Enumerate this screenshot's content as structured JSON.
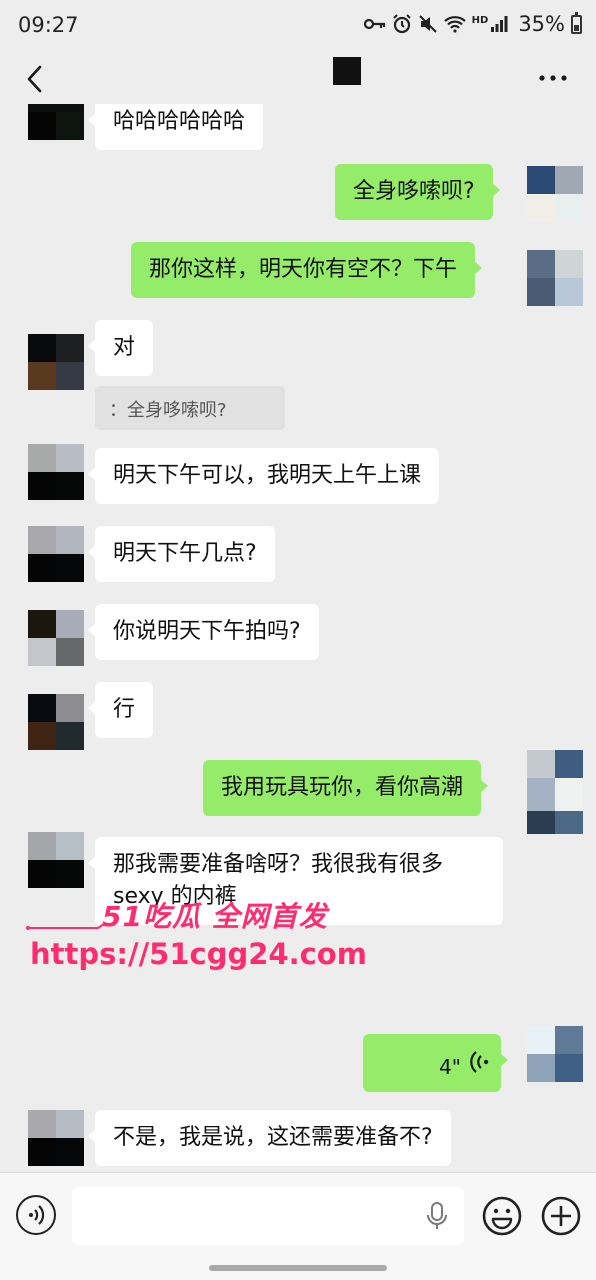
{
  "status_bar": {
    "time": "09:27",
    "battery": "35%",
    "network_label": "HD",
    "icons": [
      "key-icon",
      "alarm-icon",
      "mute-icon",
      "wifi-icon",
      "signal-icon",
      "battery-icon"
    ]
  },
  "nav": {
    "back_icon": "chevron-left-icon",
    "more_icon": "more-dots-icon"
  },
  "messages": {
    "m0": "哈哈哈哈哈哈",
    "m1": "全身哆嗦呗?",
    "m2": "那你这样，明天你有空不？下午",
    "m3": "对",
    "m3_quote": "：全身哆嗦呗?",
    "m4": "明天下午可以，我明天上午上课",
    "m5": "明天下午几点?",
    "m6": "你说明天下午拍吗?",
    "m7": "行",
    "m8": "我用玩具玩你，看你高潮",
    "m9": "那我需要准备啥呀？我很我有很多sexy 的内裤",
    "m10_voice": "4\"",
    "m11": "不是，我是说，这还需要准备不?"
  },
  "watermark": {
    "brand": "51吃瓜 全网首发",
    "url": "https://51cgg24.com"
  },
  "colors": {
    "background": "#ededed",
    "outgoing_bubble": "#95ec69",
    "incoming_bubble": "#ffffff",
    "watermark": "#ff2d6f"
  },
  "input_bar": {
    "placeholder": "",
    "icons": [
      "voice-mode-icon",
      "microphone-icon",
      "emoji-icon",
      "plus-icon"
    ]
  }
}
